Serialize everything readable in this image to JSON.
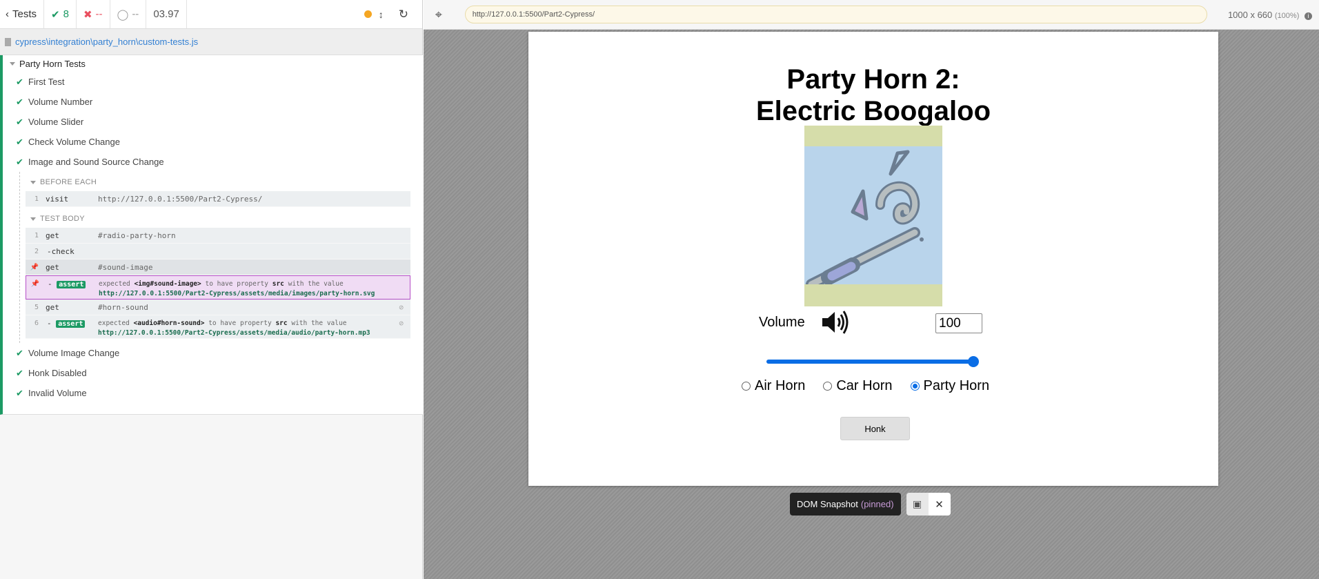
{
  "stats": {
    "back_label": "Tests",
    "passed": "8",
    "failed": "--",
    "pending": "--",
    "duration": "03.97"
  },
  "spec": {
    "path": "cypress\\integration\\party_horn\\custom-tests.js"
  },
  "suite": {
    "title": "Party Horn Tests",
    "tests_before": [
      "First Test",
      "Volume Number",
      "Volume Slider",
      "Check Volume Change",
      "Image and Sound Source Change"
    ],
    "tests_after": [
      "Volume Image Change",
      "Honk Disabled",
      "Invalid Volume"
    ]
  },
  "detail": {
    "before_each": {
      "title": "BEFORE EACH",
      "commands": [
        {
          "num": "1",
          "name": "visit",
          "msg": "http://127.0.0.1:5500/Part2-Cypress/"
        }
      ]
    },
    "test_body": {
      "title": "TEST BODY",
      "cmd1": {
        "num": "1",
        "name": "get",
        "msg": "#radio-party-horn"
      },
      "cmd2": {
        "num": "2",
        "name": "-check"
      },
      "cmd3": {
        "name": "get",
        "msg": "#sound-image"
      },
      "assert1": {
        "prefix": "-",
        "badge": "assert",
        "expected": "expected",
        "subject": "<img#sound-image>",
        "middle": "to have property",
        "prop": "src",
        "tail": "with the value",
        "url": "http://127.0.0.1:5500/Part2-Cypress/assets/media/images/party-horn.svg"
      },
      "cmd5": {
        "num": "5",
        "name": "get",
        "msg": "#horn-sound"
      },
      "assert2": {
        "num": "6",
        "prefix": "-",
        "badge": "assert",
        "expected": "expected",
        "subject": "<audio#horn-sound>",
        "middle": "to have property",
        "prop": "src",
        "tail": "with the value",
        "url": "http://127.0.0.1:5500/Part2-Cypress/assets/media/audio/party-horn.mp3"
      }
    }
  },
  "aut": {
    "url": "http://127.0.0.1:5500/Part2-Cypress/",
    "viewport": "1000 x 660",
    "scale": "(100%)",
    "app": {
      "title_line1": "Party Horn 2:",
      "title_line2": "Electric Boogaloo",
      "volume_label": "Volume",
      "volume_value": "100",
      "slider_level": 1.0,
      "radios": [
        "Air Horn",
        "Car Horn",
        "Party Horn"
      ],
      "selected_radio": "Party Horn",
      "honk_label": "Honk"
    },
    "snapshot": {
      "label": "DOM Snapshot",
      "state": "(pinned)"
    }
  },
  "colors": {
    "pass": "#1c9a64",
    "fail": "#e94f5f",
    "url_bar": "#fdf8e8",
    "accent": "#0a6de5",
    "pinned": "#b54fc7"
  },
  "icons": [
    "chevron-left-icon",
    "check-icon",
    "x-icon",
    "circle-icon",
    "dot-icon",
    "resize-icon",
    "reload-icon",
    "crosshair-icon",
    "info-icon",
    "volume-icon",
    "pin-icon",
    "eye-slash-icon",
    "close-icon"
  ]
}
